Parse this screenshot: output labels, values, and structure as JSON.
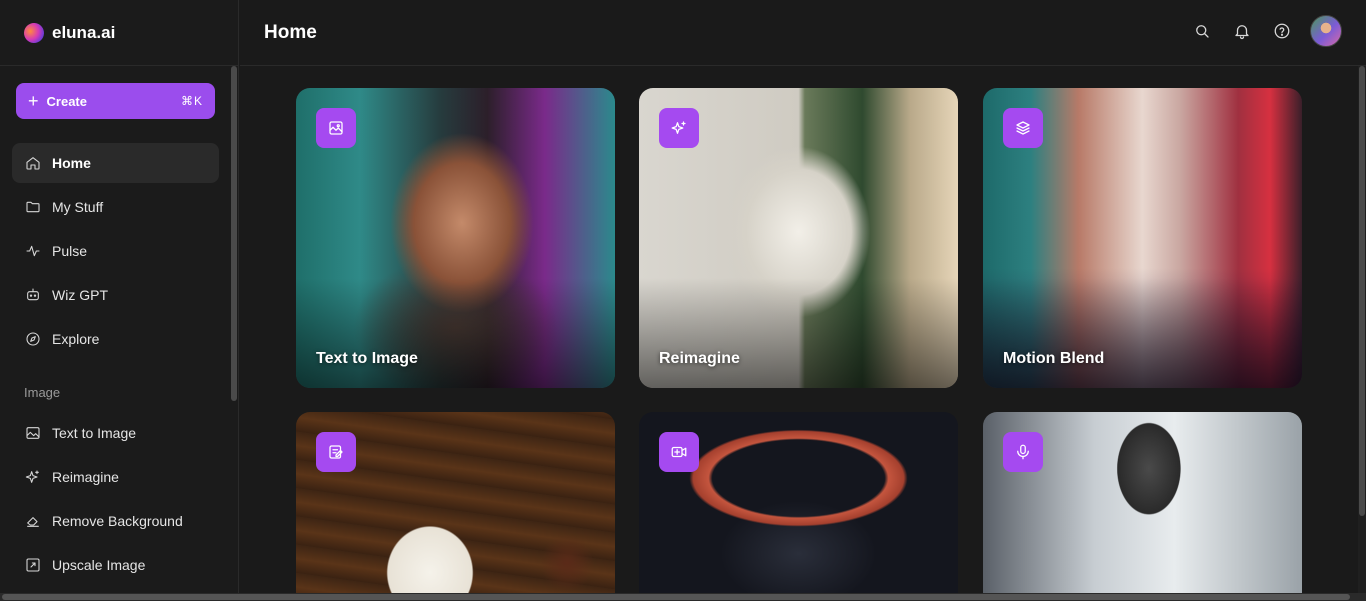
{
  "brand": {
    "name": "eluna.ai"
  },
  "create": {
    "label": "Create",
    "shortcut": "⌘K"
  },
  "nav": [
    {
      "label": "Home",
      "icon": "home-icon",
      "active": true
    },
    {
      "label": "My Stuff",
      "icon": "folder-icon"
    },
    {
      "label": "Pulse",
      "icon": "pulse-icon"
    },
    {
      "label": "Wiz GPT",
      "icon": "bot-icon"
    },
    {
      "label": "Explore",
      "icon": "compass-icon"
    }
  ],
  "image_section": {
    "title": "Image",
    "items": [
      {
        "label": "Text to Image",
        "icon": "image-icon"
      },
      {
        "label": "Reimagine",
        "icon": "sparkles-icon"
      },
      {
        "label": "Remove Background",
        "icon": "eraser-icon"
      },
      {
        "label": "Upscale Image",
        "icon": "upscale-icon"
      }
    ]
  },
  "header": {
    "title": "Home"
  },
  "cards": [
    {
      "label": "Text to Image",
      "icon": "image-icon"
    },
    {
      "label": "Reimagine",
      "icon": "sparkles-icon"
    },
    {
      "label": "Motion Blend",
      "icon": "layers-icon"
    },
    {
      "label": "",
      "icon": "edit-icon"
    },
    {
      "label": "",
      "icon": "video-plus-icon"
    },
    {
      "label": "",
      "icon": "microphone-icon"
    }
  ],
  "colors": {
    "accent": "#9b4ded",
    "badge": "#a54af0",
    "background": "#1a1a1a"
  }
}
